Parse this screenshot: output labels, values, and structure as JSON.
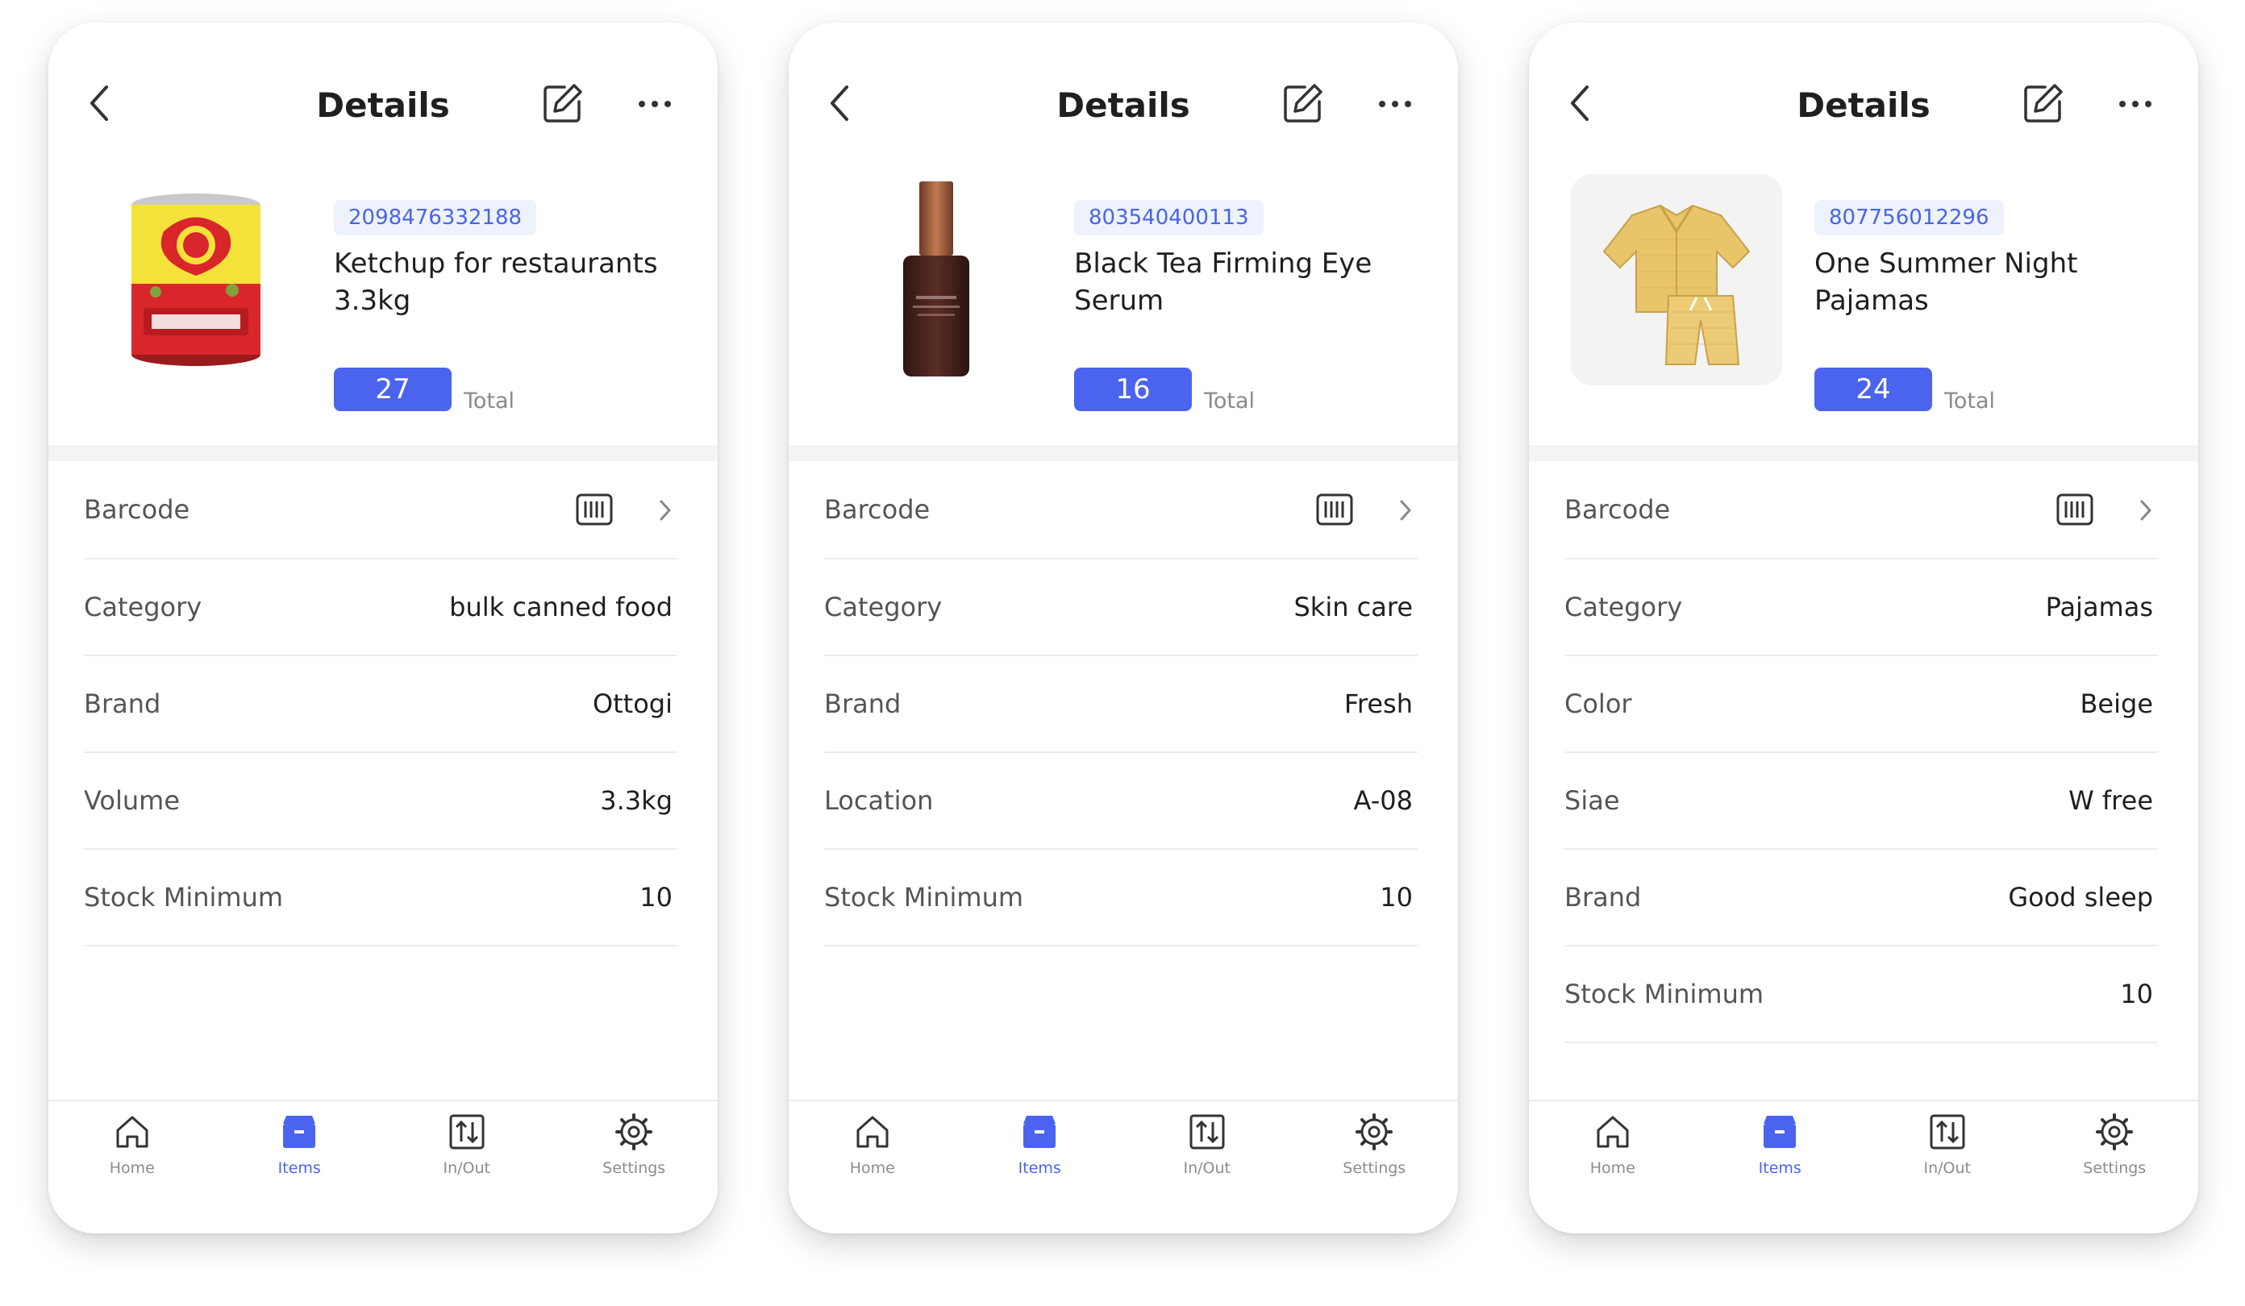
{
  "colors": {
    "accent": "#4a64f0",
    "badge_bg": "#eef2fd",
    "text": "#1f1f1f",
    "muted": "#8a8a8a"
  },
  "nav": {
    "home": "Home",
    "items": "Items",
    "inout": "In/Out",
    "settings": "Settings"
  },
  "screens": [
    {
      "title": "Details",
      "barcode_number": "2098476332188",
      "name": "Ketchup for restaurants 3.3kg",
      "quantity": "27",
      "quantity_label": "Total",
      "image": "ketchup-can",
      "rows": [
        {
          "label": "Barcode",
          "value": ""
        },
        {
          "label": "Category",
          "value": "bulk canned food"
        },
        {
          "label": "Brand",
          "value": "Ottogi"
        },
        {
          "label": "Volume",
          "value": "3.3kg"
        },
        {
          "label": "Stock Minimum",
          "value": "10"
        }
      ]
    },
    {
      "title": "Details",
      "barcode_number": "803540400113",
      "name": "Black Tea Firming Eye Serum",
      "quantity": "16",
      "quantity_label": "Total",
      "image": "serum-bottle",
      "rows": [
        {
          "label": "Barcode",
          "value": ""
        },
        {
          "label": "Category",
          "value": "Skin care"
        },
        {
          "label": "Brand",
          "value": "Fresh"
        },
        {
          "label": "Location",
          "value": "A-08"
        },
        {
          "label": "Stock Minimum",
          "value": "10"
        }
      ]
    },
    {
      "title": "Details",
      "barcode_number": "807756012296",
      "name": "One Summer Night Pajamas",
      "quantity": "24",
      "quantity_label": "Total",
      "image": "pajamas",
      "rows": [
        {
          "label": "Barcode",
          "value": ""
        },
        {
          "label": "Category",
          "value": "Pajamas"
        },
        {
          "label": "Color",
          "value": "Beige"
        },
        {
          "label": "Siae",
          "value": "W free"
        },
        {
          "label": "Brand",
          "value": "Good sleep"
        },
        {
          "label": "Stock Minimum",
          "value": "10"
        }
      ]
    }
  ]
}
